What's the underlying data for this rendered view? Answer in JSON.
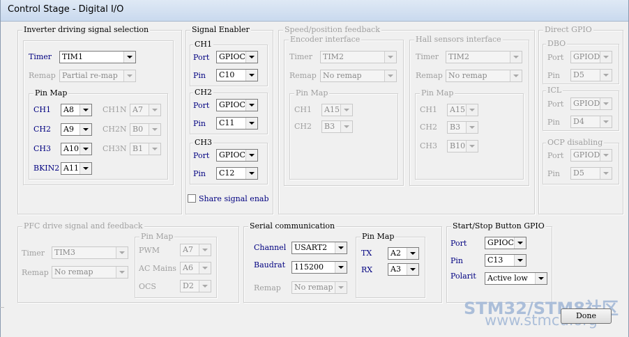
{
  "window": {
    "title": "Control Stage - Digital I/O"
  },
  "inverter": {
    "title": "Inverter driving signal selection",
    "timer_label": "Timer",
    "timer": "TIM1",
    "remap_label": "Remap",
    "remap": "Partial re-map",
    "pinmap_title": "Pin Map",
    "ch1": "CH1",
    "ch1_val": "A8",
    "ch1n": "CH1N",
    "ch1n_val": "A7",
    "ch2": "CH2",
    "ch2_val": "A9",
    "ch2n": "CH2N",
    "ch2n_val": "B0",
    "ch3": "CH3",
    "ch3_val": "A10",
    "ch3n": "CH3N",
    "ch3n_val": "B1",
    "bkin2": "BKIN2",
    "bkin2_val": "A11"
  },
  "signal_enabler": {
    "title": "Signal Enabler",
    "ch1": "CH1",
    "ch1_port": "GPIOC",
    "ch1_pin": "C10",
    "ch2": "CH2",
    "ch2_port": "GPIOC",
    "ch2_pin": "C11",
    "ch3": "CH3",
    "ch3_port": "GPIOC",
    "ch3_pin": "C12",
    "port_label": "Port",
    "pin_label": "Pin",
    "share_label": "Share signal enab"
  },
  "speed": {
    "title": "Speed/position feedback",
    "encoder_title": "Encoder interface",
    "enc_timer_label": "Timer",
    "enc_timer": "TIM2",
    "enc_remap_label": "Remap",
    "enc_remap": "No remap",
    "enc_pinmap": "Pin Map",
    "enc_ch1": "CH1",
    "enc_ch1_val": "A15",
    "enc_ch2": "CH2",
    "enc_ch2_val": "B3",
    "hall_title": "Hall sensors interface",
    "hall_timer_label": "Timer",
    "hall_timer": "TIM2",
    "hall_remap_label": "Remap",
    "hall_remap": "No remap",
    "hall_pinmap": "Pin Map",
    "hall_ch1": "CH1",
    "hall_ch1_val": "A15",
    "hall_ch2": "CH2",
    "hall_ch2_val": "B3",
    "hall_ch3": "CH3",
    "hall_ch3_val": "B10"
  },
  "direct_gpio": {
    "title": "Direct GPIO",
    "dbo_title": "DBO",
    "dbo_port_label": "Port",
    "dbo_port": "GPIOD",
    "dbo_pin_label": "Pin",
    "dbo_pin": "D5",
    "icl_title": "ICL",
    "icl_port_label": "Port",
    "icl_port": "GPIOD",
    "icl_pin_label": "Pin",
    "icl_pin": "D4",
    "ocp_title": "OCP disabling",
    "ocp_port_label": "Port",
    "ocp_port": "GPIOD",
    "ocp_pin_label": "Pin",
    "ocp_pin": "D5"
  },
  "pfc": {
    "title": "PFC drive signal and feedback",
    "timer_label": "Timer",
    "timer": "TIM3",
    "remap_label": "Remap",
    "remap": "No remap",
    "pinmap_title": "Pin Map",
    "pwm_label": "PWM",
    "pwm": "A7",
    "acmains_label": "AC Mains",
    "acmains": "A6",
    "ocs_label": "OCS",
    "ocs": "D2"
  },
  "serial": {
    "title": "Serial communication",
    "channel_label": "Channel",
    "channel": "USART2",
    "baud_label": "Baudrat",
    "baud": "115200",
    "remap_label": "Remap",
    "remap": "No remap",
    "pinmap_title": "Pin Map",
    "tx_label": "TX",
    "tx": "A2",
    "rx_label": "RX",
    "rx": "A3"
  },
  "startstop": {
    "title": "Start/Stop Button GPIO",
    "port_label": "Port",
    "port": "GPIOC",
    "pin_label": "Pin",
    "pin": "C13",
    "polarity_label": "Polarit",
    "polarity": "Active low"
  },
  "done_label": "Done",
  "watermark": {
    "line1": "STM32/STM8社区",
    "line2": "www.stmcu.org"
  }
}
